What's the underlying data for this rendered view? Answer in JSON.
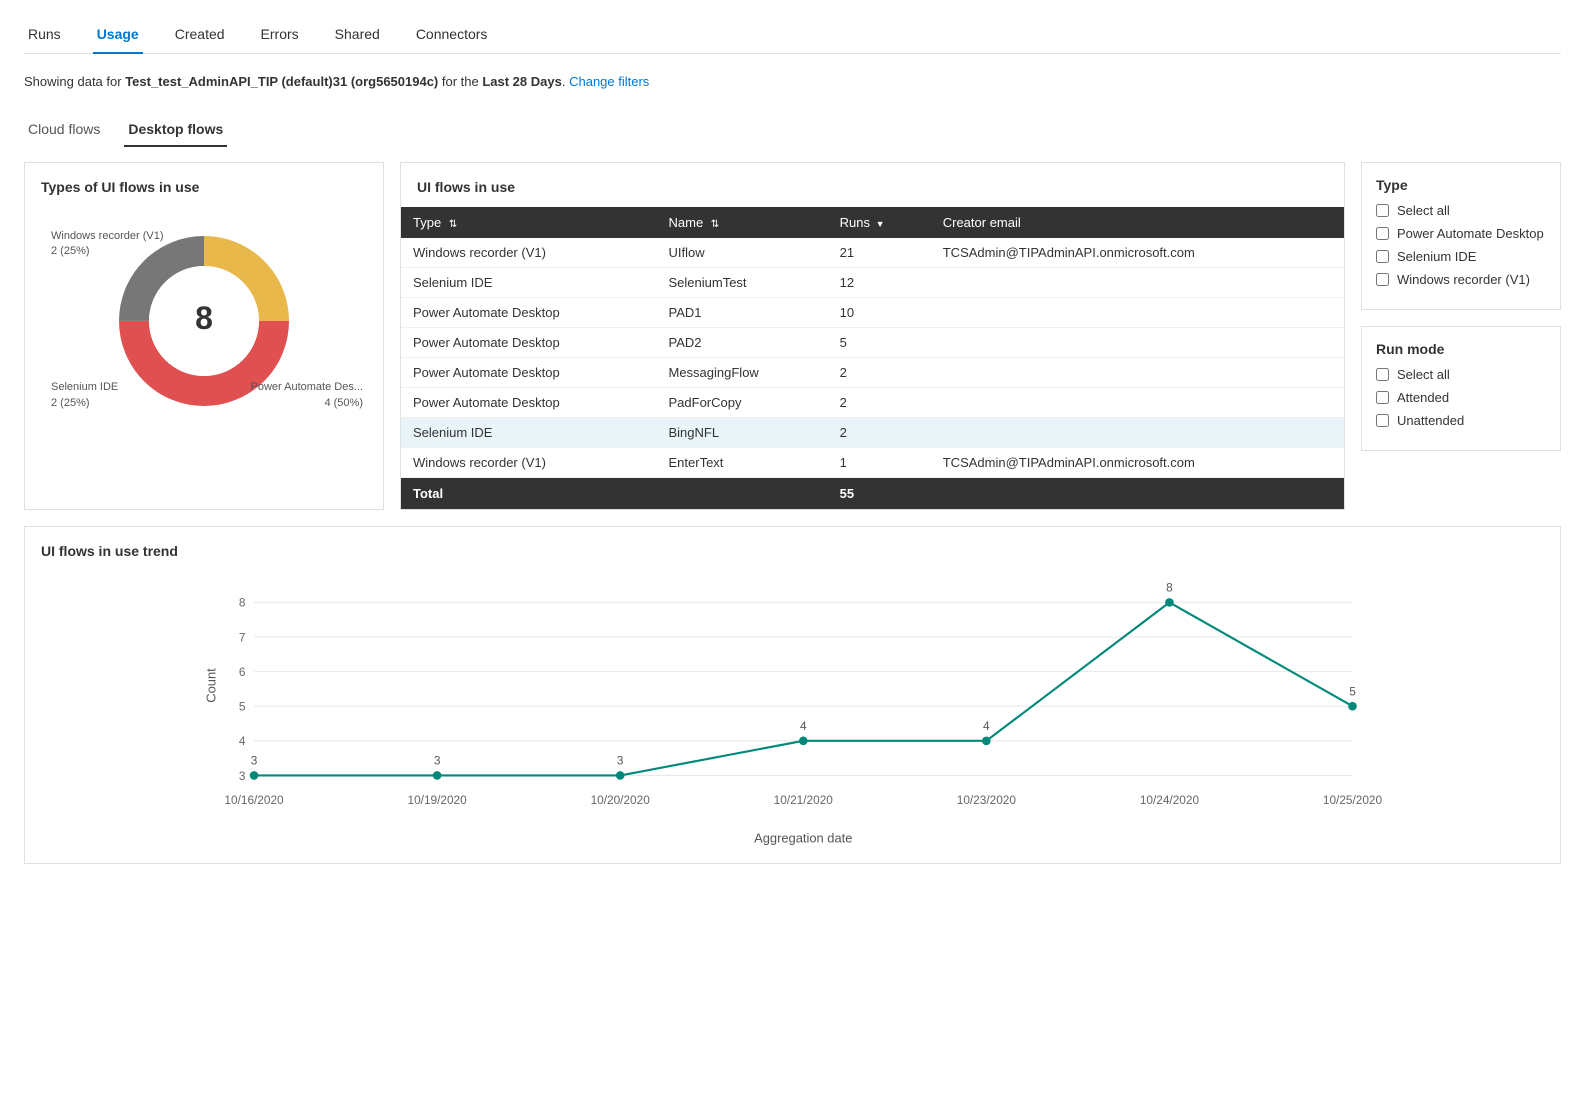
{
  "nav": {
    "items": [
      {
        "label": "Runs",
        "active": false
      },
      {
        "label": "Usage",
        "active": true
      },
      {
        "label": "Created",
        "active": false
      },
      {
        "label": "Errors",
        "active": false
      },
      {
        "label": "Shared",
        "active": false
      },
      {
        "label": "Connectors",
        "active": false
      }
    ]
  },
  "subtitle": {
    "prefix": "Showing data for ",
    "env": "Test_test_AdminAPI_TIP (default)31 (org5650194c)",
    "mid": " for the ",
    "period": "Last 28 Days",
    "suffix": ".",
    "change_filters": "Change filters"
  },
  "flow_tabs": [
    {
      "label": "Cloud flows",
      "active": false
    },
    {
      "label": "Desktop flows",
      "active": true
    }
  ],
  "donut_chart": {
    "title": "Types of UI flows in use",
    "center_value": "8",
    "segments": [
      {
        "label": "Windows recorder (V1)",
        "sublabel": "2 (25%)",
        "color": "#777",
        "percent": 25,
        "position": "top-left"
      },
      {
        "label": "Selenium IDE",
        "sublabel": "2 (25%)",
        "color": "#e8b84b",
        "percent": 25,
        "position": "bottom-left"
      },
      {
        "label": "Power Automate Des...",
        "sublabel": "4 (50%)",
        "color": "#e05050",
        "percent": 50,
        "position": "bottom-right"
      }
    ]
  },
  "table": {
    "title": "UI flows in use",
    "headers": [
      {
        "label": "Type",
        "sortable": true
      },
      {
        "label": "Name",
        "sortable": true
      },
      {
        "label": "Runs",
        "sortable": false
      },
      {
        "label": "Creator email",
        "sortable": false
      }
    ],
    "rows": [
      {
        "type": "Windows recorder (V1)",
        "name": "UIflow",
        "runs": "21",
        "email": "TCSAdmin@TIPAdminAPI.onmicrosoft.com",
        "highlighted": false
      },
      {
        "type": "Selenium IDE",
        "name": "SeleniumTest",
        "runs": "12",
        "email": "",
        "highlighted": false
      },
      {
        "type": "Power Automate Desktop",
        "name": "PAD1",
        "runs": "10",
        "email": "",
        "highlighted": false
      },
      {
        "type": "Power Automate Desktop",
        "name": "PAD2",
        "runs": "5",
        "email": "",
        "highlighted": false
      },
      {
        "type": "Power Automate Desktop",
        "name": "MessagingFlow",
        "runs": "2",
        "email": "",
        "highlighted": false
      },
      {
        "type": "Power Automate Desktop",
        "name": "PadForCopy",
        "runs": "2",
        "email": "",
        "highlighted": false
      },
      {
        "type": "Selenium IDE",
        "name": "BingNFL",
        "runs": "2",
        "email": "",
        "highlighted": true
      },
      {
        "type": "Windows recorder (V1)",
        "name": "EnterText",
        "runs": "1",
        "email": "TCSAdmin@TIPAdminAPI.onmicrosoft.com",
        "highlighted": false
      }
    ],
    "footer": {
      "label": "Total",
      "value": "55"
    }
  },
  "type_filter": {
    "title": "Type",
    "options": [
      {
        "label": "Select all",
        "checked": false
      },
      {
        "label": "Power Automate Desktop",
        "checked": false
      },
      {
        "label": "Selenium IDE",
        "checked": false
      },
      {
        "label": "Windows recorder (V1)",
        "checked": false
      }
    ]
  },
  "run_mode_filter": {
    "title": "Run mode",
    "options": [
      {
        "label": "Select all",
        "checked": false
      },
      {
        "label": "Attended",
        "checked": false
      },
      {
        "label": "Unattended",
        "checked": false
      }
    ]
  },
  "trend_chart": {
    "title": "UI flows in use trend",
    "y_axis_label": "Count",
    "x_axis_label": "Aggregation date",
    "y_max": 8,
    "y_min": 3,
    "points": [
      {
        "date": "10/16/2020",
        "value": 3
      },
      {
        "date": "10/19/2020",
        "value": 3
      },
      {
        "date": "10/20/2020",
        "value": 3
      },
      {
        "date": "10/21/2020",
        "value": 4
      },
      {
        "date": "10/23/2020",
        "value": 4
      },
      {
        "date": "10/24/2020",
        "value": 8
      },
      {
        "date": "10/25/2020",
        "value": 5
      }
    ],
    "y_ticks": [
      3,
      4,
      5,
      6,
      7,
      8
    ]
  }
}
